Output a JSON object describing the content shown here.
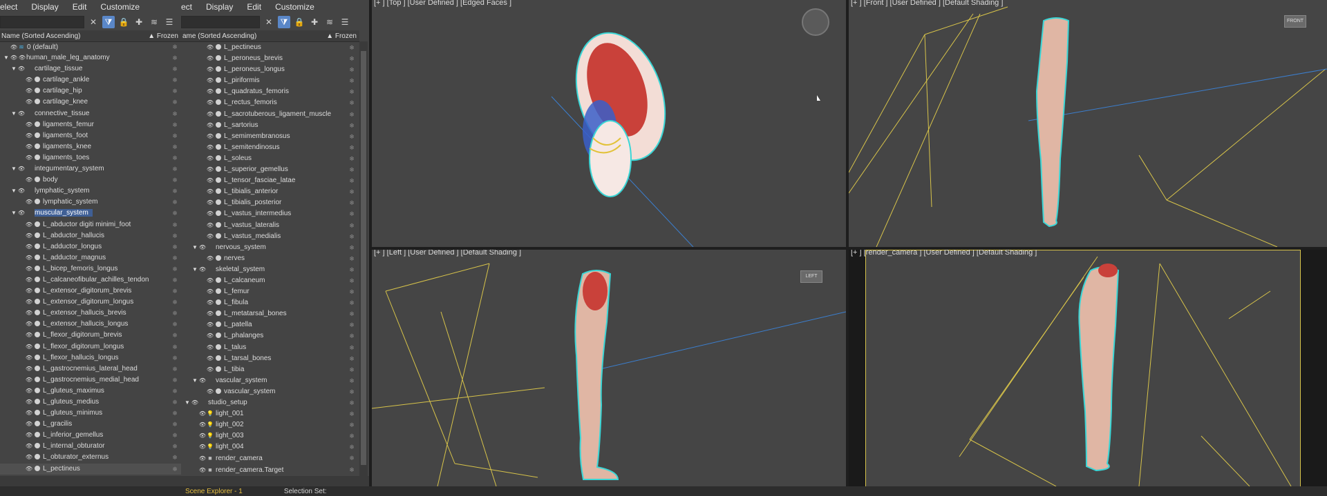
{
  "colors": {
    "accent": "#5a87c8",
    "selection": "#3f5f95",
    "camera_lines": "#d8c44a",
    "outline": "#3ad6d6",
    "skin": "#e0b6a4"
  },
  "explorer1": {
    "menu": [
      "elect",
      "Display",
      "Edit",
      "Customize"
    ],
    "col_name": "Name (Sorted Ascending)",
    "col_frozen": "▲ Frozen",
    "rows": [
      {
        "label": "0 (default)",
        "indent": 0,
        "tri": "",
        "icon": "layer-icon"
      },
      {
        "label": "human_male_leg_anatomy",
        "indent": 0,
        "tri": "▼",
        "icon": "eye-icon"
      },
      {
        "label": "cartilage_tissue",
        "indent": 1,
        "tri": "▼",
        "icon": ""
      },
      {
        "label": "cartilage_ankle",
        "indent": 2,
        "tri": "",
        "icon": "dot"
      },
      {
        "label": "cartilage_hip",
        "indent": 2,
        "tri": "",
        "icon": "dot"
      },
      {
        "label": "cartilage_knee",
        "indent": 2,
        "tri": "",
        "icon": "dot"
      },
      {
        "label": "connective_tissue",
        "indent": 1,
        "tri": "▼",
        "icon": ""
      },
      {
        "label": "ligaments_femur",
        "indent": 2,
        "tri": "",
        "icon": "dot"
      },
      {
        "label": "ligaments_foot",
        "indent": 2,
        "tri": "",
        "icon": "dot"
      },
      {
        "label": "ligaments_knee",
        "indent": 2,
        "tri": "",
        "icon": "dot"
      },
      {
        "label": "ligaments_toes",
        "indent": 2,
        "tri": "",
        "icon": "dot"
      },
      {
        "label": "integumentary_system",
        "indent": 1,
        "tri": "▼",
        "icon": ""
      },
      {
        "label": "body",
        "indent": 2,
        "tri": "",
        "icon": "dot"
      },
      {
        "label": "lymphatic_system",
        "indent": 1,
        "tri": "▼",
        "icon": ""
      },
      {
        "label": "lymphatic_system",
        "indent": 2,
        "tri": "",
        "icon": "dot"
      },
      {
        "label": "muscular_system",
        "indent": 1,
        "tri": "▼",
        "icon": "",
        "selected": true
      },
      {
        "label": "L_abductor digiti minimi_foot",
        "indent": 2,
        "tri": "",
        "icon": "dot"
      },
      {
        "label": "L_abductor_hallucis",
        "indent": 2,
        "tri": "",
        "icon": "dot"
      },
      {
        "label": "L_adductor_longus",
        "indent": 2,
        "tri": "",
        "icon": "dot"
      },
      {
        "label": "L_adductor_magnus",
        "indent": 2,
        "tri": "",
        "icon": "dot"
      },
      {
        "label": "L_bicep_femoris_longus",
        "indent": 2,
        "tri": "",
        "icon": "dot"
      },
      {
        "label": "L_calcaneofibular_achilles_tendon",
        "indent": 2,
        "tri": "",
        "icon": "dot"
      },
      {
        "label": "L_extensor_digitorum_brevis",
        "indent": 2,
        "tri": "",
        "icon": "dot"
      },
      {
        "label": "L_extensor_digitorum_longus",
        "indent": 2,
        "tri": "",
        "icon": "dot"
      },
      {
        "label": "L_extensor_hallucis_brevis",
        "indent": 2,
        "tri": "",
        "icon": "dot"
      },
      {
        "label": "L_extensor_hallucis_longus",
        "indent": 2,
        "tri": "",
        "icon": "dot"
      },
      {
        "label": "L_flexor_digitorum_brevis",
        "indent": 2,
        "tri": "",
        "icon": "dot"
      },
      {
        "label": "L_flexor_digitorum_longus",
        "indent": 2,
        "tri": "",
        "icon": "dot"
      },
      {
        "label": "L_flexor_hallucis_longus",
        "indent": 2,
        "tri": "",
        "icon": "dot"
      },
      {
        "label": "L_gastrocnemius_lateral_head",
        "indent": 2,
        "tri": "",
        "icon": "dot"
      },
      {
        "label": "L_gastrocnemius_medial_head",
        "indent": 2,
        "tri": "",
        "icon": "dot"
      },
      {
        "label": "L_gluteus_maximus",
        "indent": 2,
        "tri": "",
        "icon": "dot"
      },
      {
        "label": "L_gluteus_medius",
        "indent": 2,
        "tri": "",
        "icon": "dot"
      },
      {
        "label": "L_gluteus_minimus",
        "indent": 2,
        "tri": "",
        "icon": "dot"
      },
      {
        "label": "L_gracilis",
        "indent": 2,
        "tri": "",
        "icon": "dot"
      },
      {
        "label": "L_inferior_gemellus",
        "indent": 2,
        "tri": "",
        "icon": "dot"
      },
      {
        "label": "L_internal_obturator",
        "indent": 2,
        "tri": "",
        "icon": "dot"
      },
      {
        "label": "L_obturator_externus",
        "indent": 2,
        "tri": "",
        "icon": "dot"
      },
      {
        "label": "L_pectineus",
        "indent": 2,
        "tri": "",
        "icon": "dot",
        "hover": true
      }
    ]
  },
  "explorer2": {
    "menu": [
      "ect",
      "Display",
      "Edit",
      "Customize"
    ],
    "col_name": "ame (Sorted Ascending)",
    "col_frozen": "▲ Frozen",
    "rows": [
      {
        "label": "L_pectineus",
        "indent": 2,
        "tri": "",
        "icon": "dot"
      },
      {
        "label": "L_peroneus_brevis",
        "indent": 2,
        "tri": "",
        "icon": "dot"
      },
      {
        "label": "L_peroneus_longus",
        "indent": 2,
        "tri": "",
        "icon": "dot"
      },
      {
        "label": "L_piriformis",
        "indent": 2,
        "tri": "",
        "icon": "dot"
      },
      {
        "label": "L_quadratus_femoris",
        "indent": 2,
        "tri": "",
        "icon": "dot"
      },
      {
        "label": "L_rectus_femoris",
        "indent": 2,
        "tri": "",
        "icon": "dot"
      },
      {
        "label": "L_sacrotuberous_ligament_muscle",
        "indent": 2,
        "tri": "",
        "icon": "dot"
      },
      {
        "label": "L_sartorius",
        "indent": 2,
        "tri": "",
        "icon": "dot"
      },
      {
        "label": "L_semimembranosus",
        "indent": 2,
        "tri": "",
        "icon": "dot"
      },
      {
        "label": "L_semitendinosus",
        "indent": 2,
        "tri": "",
        "icon": "dot"
      },
      {
        "label": "L_soleus",
        "indent": 2,
        "tri": "",
        "icon": "dot"
      },
      {
        "label": "L_superior_gemellus",
        "indent": 2,
        "tri": "",
        "icon": "dot"
      },
      {
        "label": "L_tensor_fasciae_latae",
        "indent": 2,
        "tri": "",
        "icon": "dot"
      },
      {
        "label": "L_tibialis_anterior",
        "indent": 2,
        "tri": "",
        "icon": "dot"
      },
      {
        "label": "L_tibialis_posterior",
        "indent": 2,
        "tri": "",
        "icon": "dot"
      },
      {
        "label": "L_vastus_intermedius",
        "indent": 2,
        "tri": "",
        "icon": "dot"
      },
      {
        "label": "L_vastus_lateralis",
        "indent": 2,
        "tri": "",
        "icon": "dot"
      },
      {
        "label": "L_vastus_medialis",
        "indent": 2,
        "tri": "",
        "icon": "dot"
      },
      {
        "label": "nervous_system",
        "indent": 1,
        "tri": "▼",
        "icon": ""
      },
      {
        "label": "nerves",
        "indent": 2,
        "tri": "",
        "icon": "dot"
      },
      {
        "label": "skeletal_system",
        "indent": 1,
        "tri": "▼",
        "icon": ""
      },
      {
        "label": "L_calcaneum",
        "indent": 2,
        "tri": "",
        "icon": "dot"
      },
      {
        "label": "L_femur",
        "indent": 2,
        "tri": "",
        "icon": "dot"
      },
      {
        "label": "L_fibula",
        "indent": 2,
        "tri": "",
        "icon": "dot"
      },
      {
        "label": "L_metatarsal_bones",
        "indent": 2,
        "tri": "",
        "icon": "dot"
      },
      {
        "label": "L_patella",
        "indent": 2,
        "tri": "",
        "icon": "dot"
      },
      {
        "label": "L_phalanges",
        "indent": 2,
        "tri": "",
        "icon": "dot"
      },
      {
        "label": "L_talus",
        "indent": 2,
        "tri": "",
        "icon": "dot"
      },
      {
        "label": "L_tarsal_bones",
        "indent": 2,
        "tri": "",
        "icon": "dot"
      },
      {
        "label": "L_tibia",
        "indent": 2,
        "tri": "",
        "icon": "dot"
      },
      {
        "label": "vascular_system",
        "indent": 1,
        "tri": "▼",
        "icon": ""
      },
      {
        "label": "vascular_system",
        "indent": 2,
        "tri": "",
        "icon": "dot"
      },
      {
        "label": "studio_setup",
        "indent": 0,
        "tri": "▼",
        "icon": ""
      },
      {
        "label": "light_001",
        "indent": 1,
        "tri": "",
        "icon": "light-icon"
      },
      {
        "label": "light_002",
        "indent": 1,
        "tri": "",
        "icon": "light-icon"
      },
      {
        "label": "light_003",
        "indent": 1,
        "tri": "",
        "icon": "light-icon"
      },
      {
        "label": "light_004",
        "indent": 1,
        "tri": "",
        "icon": "light-icon"
      },
      {
        "label": "render_camera",
        "indent": 1,
        "tri": "",
        "icon": "camera-icon"
      },
      {
        "label": "render_camera.Target",
        "indent": 1,
        "tri": "",
        "icon": "camera-icon"
      }
    ]
  },
  "viewports": {
    "top": {
      "label": "[+ ] [Top ] [User Defined ] [Edged Faces ]"
    },
    "front": {
      "label": "[+ ] [Front ] [User Defined ] [Default Shading ]"
    },
    "left": {
      "label": "[+ ] [Left ] [User Defined ] [Default Shading ]"
    },
    "camera": {
      "label": "[+ ] [render_camera ] [User Defined ] [Default Shading ]"
    }
  },
  "status": {
    "scene_explorer": "Scene Explorer - 1",
    "selection": "Selection Set:"
  }
}
